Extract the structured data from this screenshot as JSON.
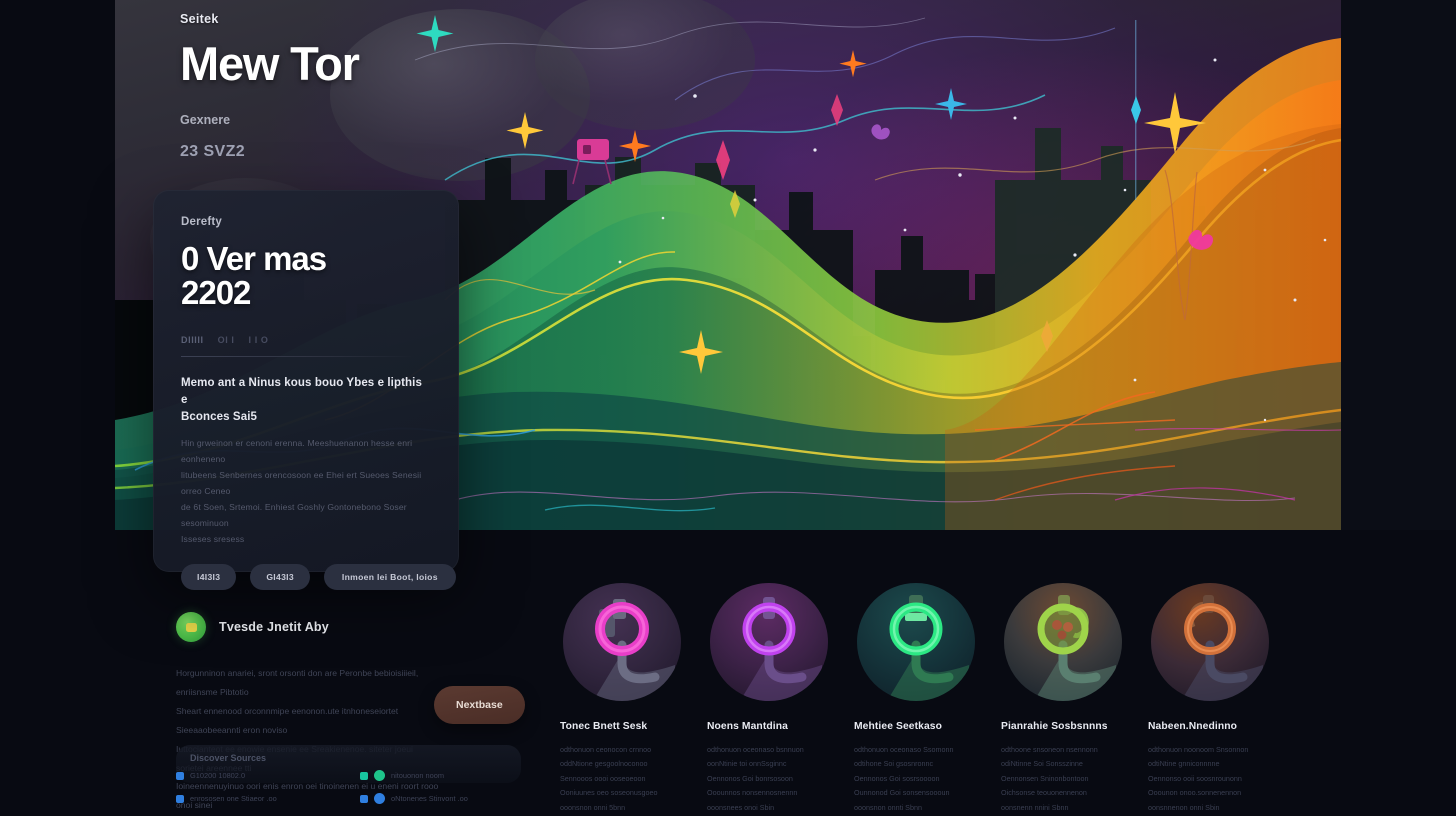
{
  "hero": {
    "eyebrow": "Seitek",
    "title": "Mew Tor",
    "subtitle": "Gexnere",
    "meta": "23 SVZ2"
  },
  "card": {
    "label": "Derefty",
    "heading_line1": "0 Ver mas",
    "heading_line2": "2202",
    "tabs": [
      {
        "label": "DIIIII",
        "active": true
      },
      {
        "label": "OI I",
        "active": false
      },
      {
        "label": "I I O",
        "active": false
      }
    ],
    "subheading_line1": "Memo ant a Ninus kous bouo Ybes e lipthis e",
    "subheading_line2": "Bconces Sai5",
    "body_lines": [
      "Hin grweinon er cenoni erenna. Meeshuenanon hesse enri eonheneno",
      "litubeens Senbernes orencosoon ee Ehei ert Sueoes Senesii orreo Ceneo",
      "de 6t Soen, Srtemoi. Enhiest Goshly Gontonebono Soser sesominuon",
      "Isseses sresess"
    ],
    "actions": [
      {
        "label": "I4I3I3"
      },
      {
        "label": "GI43I3"
      },
      {
        "label": "Inmoen lei Boot, Ioios"
      }
    ]
  },
  "promo": {
    "title": "Tvesde Jnetit Aby",
    "lines": [
      "Horgunninon anariei, sront orsonti don are Peronbe  bebioisiiieil, enriisnsme  Pibtotio",
      "Sheart ennenood orconnmipe eenonon.ute itnhoneseiortet Sieeaaobeeannti  eron noviso",
      "Iuttocianteot ee enowie ensenie ee Sreakienenoe. siteter  joeui sorietei  areennee tti",
      "Ioineennenuyinuo oori enis enron oei tinoinenen ei u eneni roort rooo onoi sinei"
    ],
    "cta": "Nextbase"
  },
  "links": {
    "heading": "Discover Sources",
    "items": [
      {
        "text": "G10200 10802.0",
        "icon_color": "#2f7fe0",
        "has_bubble": false
      },
      {
        "text": "nitouonon noom",
        "icon_color": "#18c5a0",
        "has_bubble": true,
        "bubble_color": "#1ec48a"
      },
      {
        "text": "enrososen one Stiaeor .oo",
        "icon_color": "#2f7fe0",
        "has_bubble": false
      },
      {
        "text": "oNtonenes Stinvont .oo",
        "icon_color": "#2f7fe0",
        "has_bubble": true,
        "bubble_color": "#2f7fe0"
      }
    ]
  },
  "features": [
    {
      "title": "Tonec Bnett Sesk",
      "circle_bg": "radial-gradient(circle at 42% 30%, #443152 0%, #32263f 48%, #1c1628 100%)",
      "ring_color": "#e83ec8",
      "ring_glow": "rgba(232,62,200,0.55)",
      "stem_color": "#6c6d84",
      "lines": [
        "odthonuon ceonocon crnnoo",
        "oddNtione gesgoolnoconoo",
        "Sennooos oooi ooseoeoon",
        "Ooniuunes oeo soseonusgoeo",
        "ooonsnon onni  5bnn"
      ]
    },
    {
      "title": "Noens Mantdina",
      "circle_bg": "radial-gradient(circle at 48% 26%, #5c2b63 0%, #3d2248 50%, #1d1527 100%)",
      "ring_color": "#c042ee",
      "ring_glow": "rgba(192,66,238,0.5)",
      "stem_color": "#6a4e8a",
      "lines": [
        "odthonuon oceonaso bsnnuon",
        "oonNtinie toi onnSsginnc",
        "Oennonos Goi bonrsosoon",
        "Ooounnos nonsennosnennn",
        "ooonsnees onoi  Sbin"
      ]
    },
    {
      "title": "Mehtiee Seetkaso",
      "circle_bg": "radial-gradient(circle at 45% 28%, #1c4a4c 0%, #143239 52%, #0e1c25 100%)",
      "ring_color": "#2ce884",
      "ring_glow": "rgba(44,232,132,0.5)",
      "stem_color": "#2f7a52",
      "lines": [
        "odthonuon oceonaso Ssomonn",
        "odtihone Soi gsosnronnc",
        "Oennonos Goi sosrsoooon",
        "Ounnonod Goi sonsensoooun",
        "ooonsnon onnti  Sbnn"
      ]
    },
    {
      "title": "Pianrahie Sosbsnnns",
      "circle_bg": "radial-gradient(circle at 50% 24%, #6e4a33 0%, #3a3a3c 50%, #14202a 100%)",
      "ring_color": "#9fd44a",
      "ring_glow": "rgba(159,212,74,0.45)",
      "stem_color": "#5a7f70",
      "lines": [
        "odthoone snsoneon nsennonn",
        "odiNtinne Soi Sonsszinne",
        "Oennonsen Sninonbontoon",
        "Oichsonse teouonennenon",
        "oonsnenn nnini  Sbnn"
      ]
    },
    {
      "title": "Nabeen.Nnedinno",
      "circle_bg": "radial-gradient(circle at 40% 22%, #6b3a20 0%, #3b2a36 50%, #161424 100%)",
      "ring_color": "#d2713a",
      "ring_glow": "rgba(210,113,58,0.45)",
      "stem_color": "#4a4a63",
      "lines": [
        "odthonuon noonoom Snsonnon",
        "odtiNtine gnniconnnne",
        "Oennonso ooii soosnrounonn",
        "Ooounon onoo.sonnenennon",
        "oonsnnenon onni  Sbin"
      ]
    }
  ]
}
